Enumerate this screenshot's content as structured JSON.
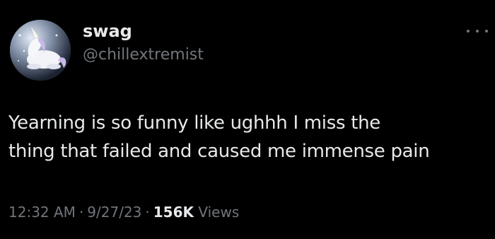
{
  "author": {
    "display_name": "swag",
    "handle": "@chillextremist",
    "avatar_icon": "unicorn-avatar-icon"
  },
  "more_icon": "more-options-icon",
  "tweet": {
    "line1": "Yearning is so funny like ughhh I miss the",
    "line2": "thing that failed and caused me immense pain"
  },
  "meta": {
    "time": "12:32 AM",
    "separator": "·",
    "date": "9/27/23",
    "views_count": "156K",
    "views_label": "Views"
  },
  "colors": {
    "background": "#000000",
    "text": "#e7e9ea",
    "secondary": "#71767b"
  }
}
